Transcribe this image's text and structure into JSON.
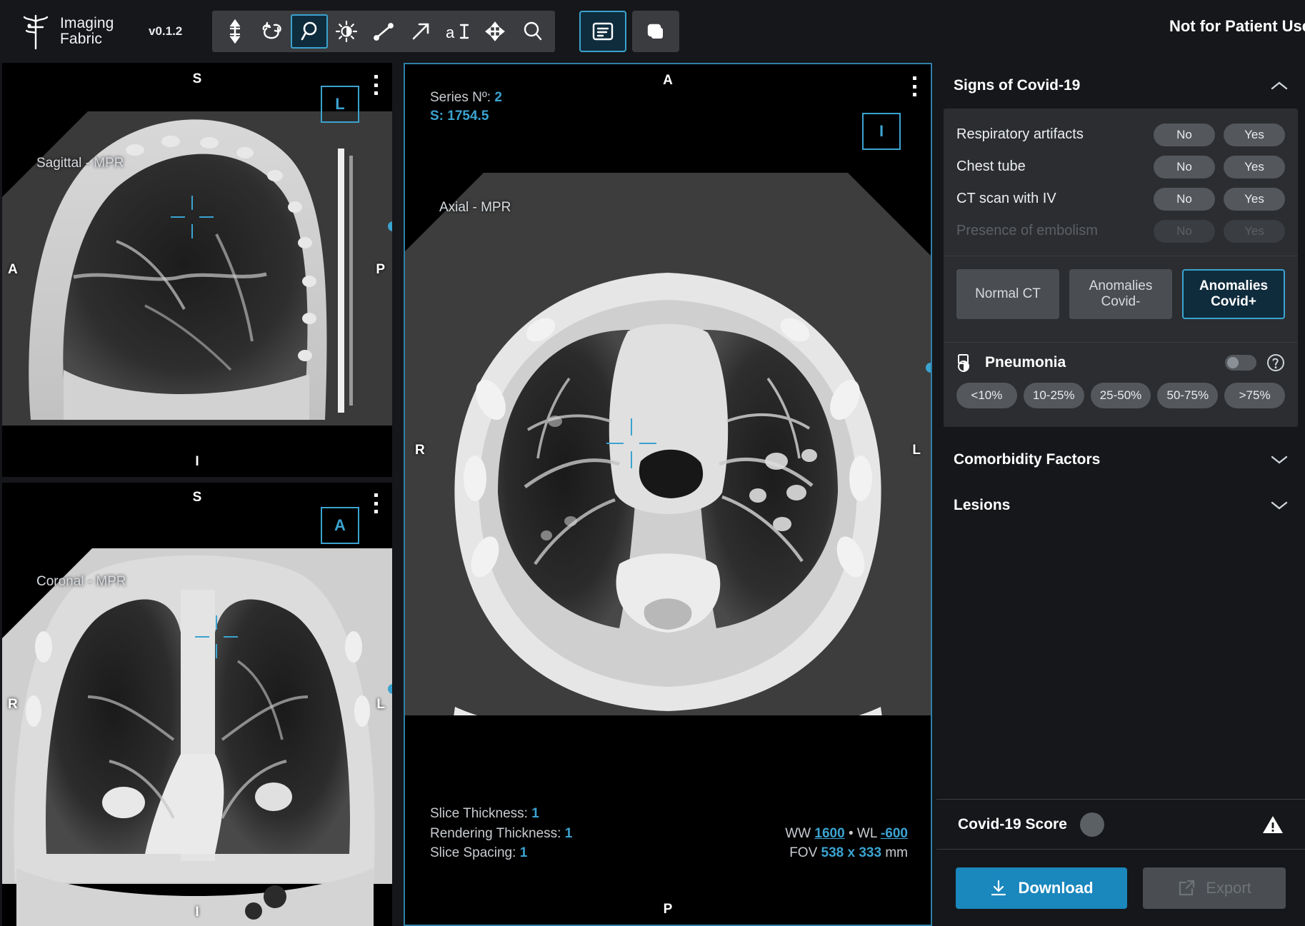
{
  "app": {
    "brand_line1": "Imaging",
    "brand_line2": "Fabric",
    "version": "v0.1.2",
    "disclaimer": "Not for Patient Use",
    "accent": "#3ba3d0",
    "primary": "#1a87bd"
  },
  "toolbar": {
    "tools": [
      {
        "name": "scroll-slices-icon",
        "label": "Scroll"
      },
      {
        "name": "rotate-3d-icon",
        "label": "Rotate"
      },
      {
        "name": "zoom-pan-icon",
        "label": "Zoom",
        "active": true
      },
      {
        "name": "windowing-icon",
        "label": "Window Level"
      },
      {
        "name": "length-measure-icon",
        "label": "Length"
      },
      {
        "name": "arrow-annotation-icon",
        "label": "Arrow"
      },
      {
        "name": "text-annotation-icon",
        "label": "Text"
      },
      {
        "name": "pan-move-icon",
        "label": "Pan"
      },
      {
        "name": "magnify-icon",
        "label": "Magnify"
      }
    ],
    "right_tools": [
      {
        "name": "report-panel-icon",
        "label": "Report Panel",
        "active": true
      },
      {
        "name": "layout-stack-icon",
        "label": "Layout",
        "active": false
      }
    ]
  },
  "viewports": {
    "sagittal": {
      "label": "Sagittal - MPR",
      "orient_top": "S",
      "orient_bottom": "I",
      "orient_left": "A",
      "orient_right": "P",
      "corner_marker": "L"
    },
    "coronal": {
      "label": "Coronal - MPR",
      "orient_top": "S",
      "orient_bottom": "I",
      "orient_left": "R",
      "orient_right": "L",
      "corner_marker": "A"
    },
    "axial": {
      "label": "Axial - MPR",
      "orient_top": "A",
      "orient_bottom": "P",
      "orient_left": "R",
      "orient_right": "L",
      "corner_marker": "I",
      "series_label": "Series Nº:",
      "series_value": "2",
      "slice_label": "S:",
      "slice_value": "1754.5",
      "slice_thickness_label": "Slice Thickness:",
      "slice_thickness_value": "1",
      "rendering_thickness_label": "Rendering Thickness:",
      "rendering_thickness_value": "1",
      "slice_spacing_label": "Slice Spacing:",
      "slice_spacing_value": "1",
      "ww_label": "WW",
      "ww_value": "1600",
      "wl_label": "WL",
      "wl_value": "-600",
      "sep": "•",
      "fov_label": "FOV",
      "fov_value": "538 x 333",
      "fov_unit": "mm"
    }
  },
  "panel": {
    "sections": [
      {
        "title": "Signs of Covid-19",
        "expanded": true
      },
      {
        "title": "Comorbidity Factors",
        "expanded": false
      },
      {
        "title": "Lesions",
        "expanded": false
      }
    ],
    "questions": [
      {
        "label": "Respiratory artifacts",
        "no": "No",
        "yes": "Yes",
        "disabled": false
      },
      {
        "label": "Chest tube",
        "no": "No",
        "yes": "Yes",
        "disabled": false
      },
      {
        "label": "CT scan with IV",
        "no": "No",
        "yes": "Yes",
        "disabled": false
      },
      {
        "label": "Presence of embolism",
        "no": "No",
        "yes": "Yes",
        "disabled": true
      }
    ],
    "classification": [
      {
        "label": "Normal CT",
        "selected": false
      },
      {
        "label": "Anomalies\nCovid-",
        "line1": "Anomalies",
        "line2": "Covid-",
        "selected": false
      },
      {
        "label": "Anomalies\nCovid+",
        "line1": "Anomalies",
        "line2": "Covid+",
        "selected": true
      }
    ],
    "pneumonia": {
      "title": "Pneumonia",
      "toggle_on": false,
      "percentages": [
        "<10%",
        "10-25%",
        "25-50%",
        "50-75%",
        ">75%"
      ]
    },
    "footer": {
      "score_label": "Covid-19 Score",
      "score_value": "",
      "download_label": "Download",
      "export_label": "Export",
      "export_disabled": true
    }
  }
}
